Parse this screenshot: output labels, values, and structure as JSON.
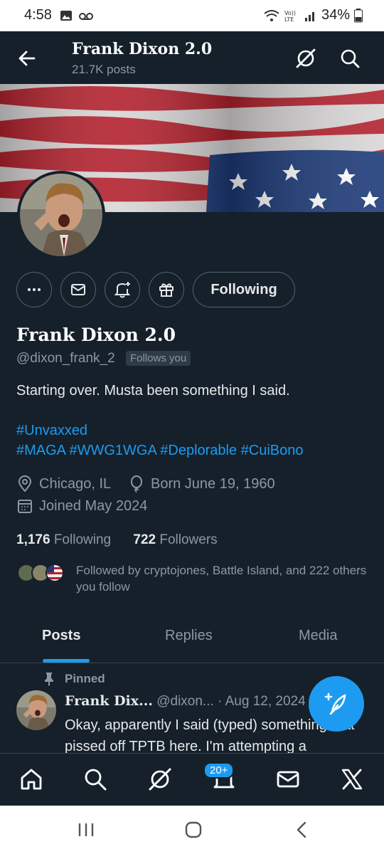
{
  "status_bar": {
    "time": "4:58",
    "battery": "34%"
  },
  "header": {
    "name": "Frank Dixon 2.0",
    "posts": "21.7K posts"
  },
  "actions": {
    "following_label": "Following"
  },
  "profile": {
    "name": "Frank Dixon 2.0",
    "handle": "@dixon_frank_2",
    "follows_you": "Follows you",
    "bio": "Starting over. Musta been something I said.",
    "hashtags_line1": "#Unvaxxed",
    "hashtags_line2": "#MAGA #WWG1WGA #Deplorable #CuiBono",
    "location": "Chicago, IL",
    "born": "Born June 19, 1960",
    "joined": "Joined May 2024",
    "following_count": "1,176",
    "following_label": "Following",
    "followers_count": "722",
    "followers_label": "Followers",
    "followed_by": "Followed by cryptojones, Battle Island, and 222 others you follow"
  },
  "tabs": [
    {
      "label": "Posts",
      "active": true
    },
    {
      "label": "Replies",
      "active": false
    },
    {
      "label": "Media",
      "active": false
    }
  ],
  "tweet": {
    "pinned_label": "Pinned",
    "name": "Frank Dix...",
    "handle": "@dixon...",
    "date": "· Aug 12, 2024",
    "text": "Okay, apparently I said (typed) something that pissed off TPTB here. I'm attempting a"
  },
  "bottom_nav": {
    "notifications_badge": "20+"
  },
  "colors": {
    "background": "#15202b",
    "accent": "#1d9bf0",
    "muted": "#8b98a5"
  }
}
